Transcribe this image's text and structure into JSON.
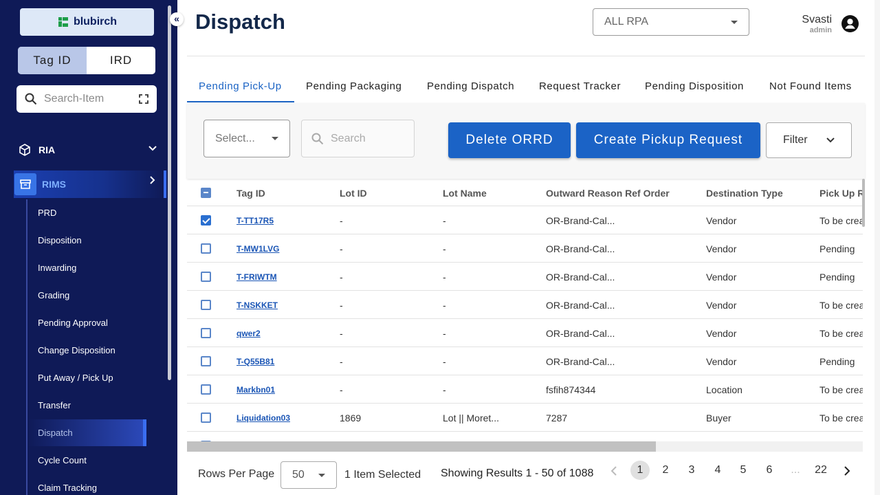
{
  "brand": {
    "name": "blubirch"
  },
  "sidebar": {
    "toggle": [
      "Tag ID",
      "IRD"
    ],
    "search_placeholder": "Search-Item",
    "sections": [
      {
        "label": "RIA"
      },
      {
        "label": "RIMS"
      }
    ],
    "rims_items": [
      {
        "label": "PRD"
      },
      {
        "label": "Disposition"
      },
      {
        "label": "Inwarding"
      },
      {
        "label": "Grading"
      },
      {
        "label": "Pending Approval"
      },
      {
        "label": "Change Disposition"
      },
      {
        "label": "Put Away / Pick Up"
      },
      {
        "label": "Transfer"
      },
      {
        "label": "Dispatch"
      },
      {
        "label": "Cycle Count"
      },
      {
        "label": "Claim Tracking"
      }
    ]
  },
  "header": {
    "title": "Dispatch",
    "rpa_select": "ALL RPA",
    "user_name": "Svasti",
    "user_role": "admin"
  },
  "tabs": [
    {
      "label": "Pending Pick-Up"
    },
    {
      "label": "Pending Packaging"
    },
    {
      "label": "Pending Dispatch"
    },
    {
      "label": "Request Tracker"
    },
    {
      "label": "Pending Disposition"
    },
    {
      "label": "Not Found Items"
    }
  ],
  "toolbar": {
    "select_placeholder": "Select...",
    "search_placeholder": "Search",
    "delete_label": "Delete ORRD",
    "create_label": "Create Pickup Request",
    "filter_label": "Filter"
  },
  "table": {
    "columns": [
      "Tag ID",
      "Lot ID",
      "Lot Name",
      "Outward Reason Ref Order",
      "Destination Type",
      "Pick Up R"
    ],
    "rows": [
      {
        "checked": true,
        "tag": "T-TT17R5",
        "lot_id": "-",
        "lot_name": "-",
        "ref": "OR-Brand-Cal...",
        "dest": "Vendor",
        "pickup": "To be crea"
      },
      {
        "checked": false,
        "tag": "T-MW1LVG",
        "lot_id": "-",
        "lot_name": "-",
        "ref": "OR-Brand-Cal...",
        "dest": "Vendor",
        "pickup": "Pending"
      },
      {
        "checked": false,
        "tag": "T-FRIWTM",
        "lot_id": "-",
        "lot_name": "-",
        "ref": "OR-Brand-Cal...",
        "dest": "Vendor",
        "pickup": "Pending"
      },
      {
        "checked": false,
        "tag": "T-NSKKET",
        "lot_id": "-",
        "lot_name": "-",
        "ref": "OR-Brand-Cal...",
        "dest": "Vendor",
        "pickup": "To be crea"
      },
      {
        "checked": false,
        "tag": "qwer2",
        "lot_id": "-",
        "lot_name": "-",
        "ref": "OR-Brand-Cal...",
        "dest": "Vendor",
        "pickup": "To be crea"
      },
      {
        "checked": false,
        "tag": "T-Q55B81",
        "lot_id": "-",
        "lot_name": "-",
        "ref": "OR-Brand-Cal...",
        "dest": "Vendor",
        "pickup": "Pending"
      },
      {
        "checked": false,
        "tag": "Markbn01",
        "lot_id": "-",
        "lot_name": "-",
        "ref": "fsfih874344",
        "dest": "Location",
        "pickup": "To be crea"
      },
      {
        "checked": false,
        "tag": "Liquidation03",
        "lot_id": "1869",
        "lot_name": "Lot || Moret...",
        "ref": "7287",
        "dest": "Buyer",
        "pickup": "To be crea"
      }
    ]
  },
  "footer": {
    "rows_per_page_label": "Rows Per Page",
    "rows_per_page": "50",
    "selected": "1 Item Selected",
    "showing": "Showing Results 1 - 50 of 1088",
    "pages": [
      "1",
      "2",
      "3",
      "4",
      "5",
      "6",
      "...",
      "22"
    ],
    "current_page": "1"
  },
  "colors": {
    "sidebar_bg": "#0f1a57",
    "primary": "#1b63c6",
    "accent_tab": "#1a63c4"
  }
}
